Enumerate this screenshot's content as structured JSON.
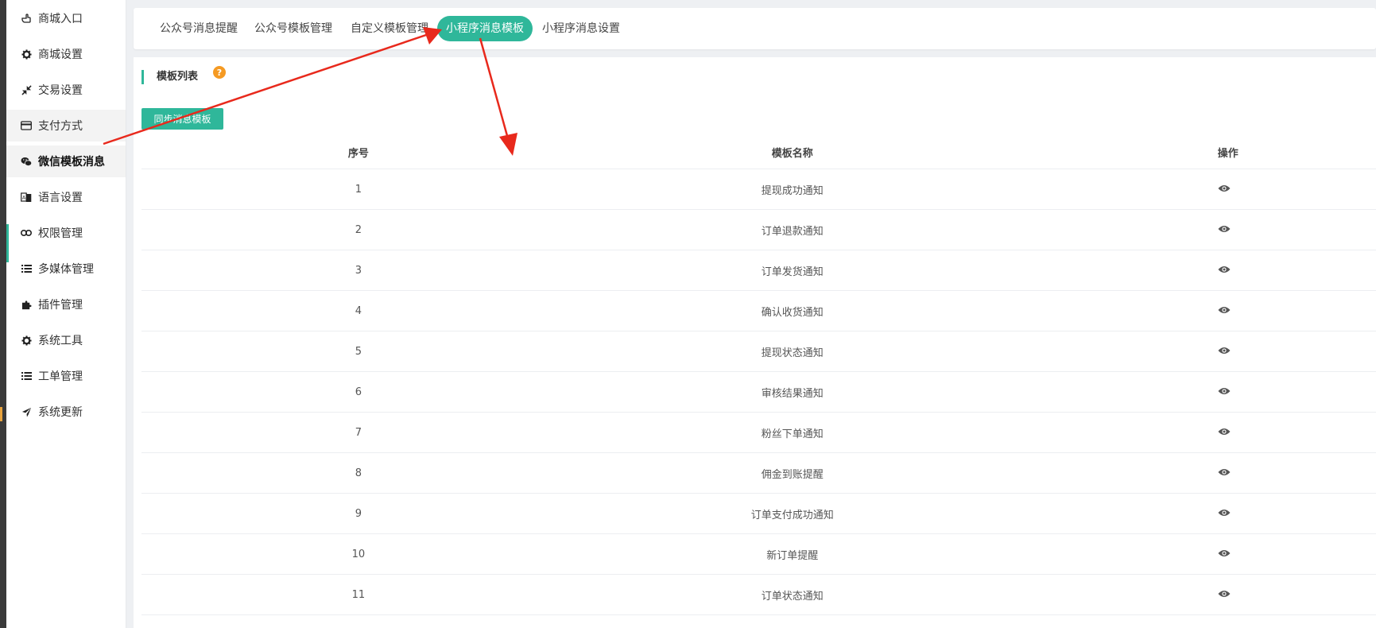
{
  "sidebar": {
    "items": [
      {
        "label": "商城入口",
        "icon": "hand-pointer-icon"
      },
      {
        "label": "商城设置",
        "icon": "gear-icon"
      },
      {
        "label": "交易设置",
        "icon": "compress-icon"
      },
      {
        "label": "支付方式",
        "icon": "credit-card-icon"
      },
      {
        "label": "微信模板消息",
        "icon": "wechat-icon"
      },
      {
        "label": "语言设置",
        "icon": "language-icon"
      },
      {
        "label": "权限管理",
        "icon": "users-icon"
      },
      {
        "label": "多媒体管理",
        "icon": "list-icon"
      },
      {
        "label": "插件管理",
        "icon": "puzzle-icon"
      },
      {
        "label": "系统工具",
        "icon": "gear-icon"
      },
      {
        "label": "工单管理",
        "icon": "list-icon"
      },
      {
        "label": "系统更新",
        "icon": "paper-plane-icon"
      }
    ]
  },
  "tabs": [
    {
      "label": "公众号消息提醒"
    },
    {
      "label": "公众号模板管理"
    },
    {
      "label": "自定义模板管理"
    },
    {
      "label": "小程序消息模板"
    },
    {
      "label": "小程序消息设置"
    }
  ],
  "section": {
    "title": "模板列表",
    "help": "?"
  },
  "sync_button": {
    "label": "同步消息模板"
  },
  "table": {
    "headers": {
      "index": "序号",
      "name": "模板名称",
      "action": "操作"
    },
    "rows": [
      {
        "index": "1",
        "name": "提现成功通知"
      },
      {
        "index": "2",
        "name": "订单退款通知"
      },
      {
        "index": "3",
        "name": "订单发货通知"
      },
      {
        "index": "4",
        "name": "确认收货通知"
      },
      {
        "index": "5",
        "name": "提现状态通知"
      },
      {
        "index": "6",
        "name": "审核结果通知"
      },
      {
        "index": "7",
        "name": "粉丝下单通知"
      },
      {
        "index": "8",
        "name": "佣金到账提醒"
      },
      {
        "index": "9",
        "name": "订单支付成功通知"
      },
      {
        "index": "10",
        "name": "新订单提醒"
      },
      {
        "index": "11",
        "name": "订单状态通知"
      }
    ]
  },
  "colors": {
    "accent": "#2fb79a",
    "help": "#f59a23",
    "annotation": "#e8291c"
  }
}
